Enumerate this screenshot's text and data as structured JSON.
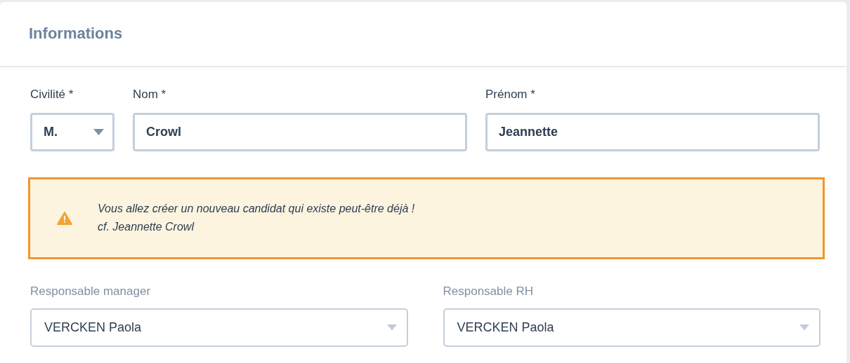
{
  "card": {
    "title": "Informations"
  },
  "identity_fields": [
    {
      "label": "Civilité *",
      "value": "M.",
      "kind": "select"
    },
    {
      "label": "Nom *",
      "value": "Crowl",
      "kind": "text"
    },
    {
      "label": "Prénom *",
      "value": "Jeannette",
      "kind": "text"
    }
  ],
  "alert": {
    "lines": [
      "Vous allez créer un nouveau candidat qui existe peut-être déjà !",
      "cf. Jeannette Crowl"
    ]
  },
  "responsables": [
    {
      "label": "Responsable manager",
      "value": "VERCKEN Paola"
    },
    {
      "label": "Responsable RH",
      "value": "VERCKEN Paola"
    }
  ]
}
